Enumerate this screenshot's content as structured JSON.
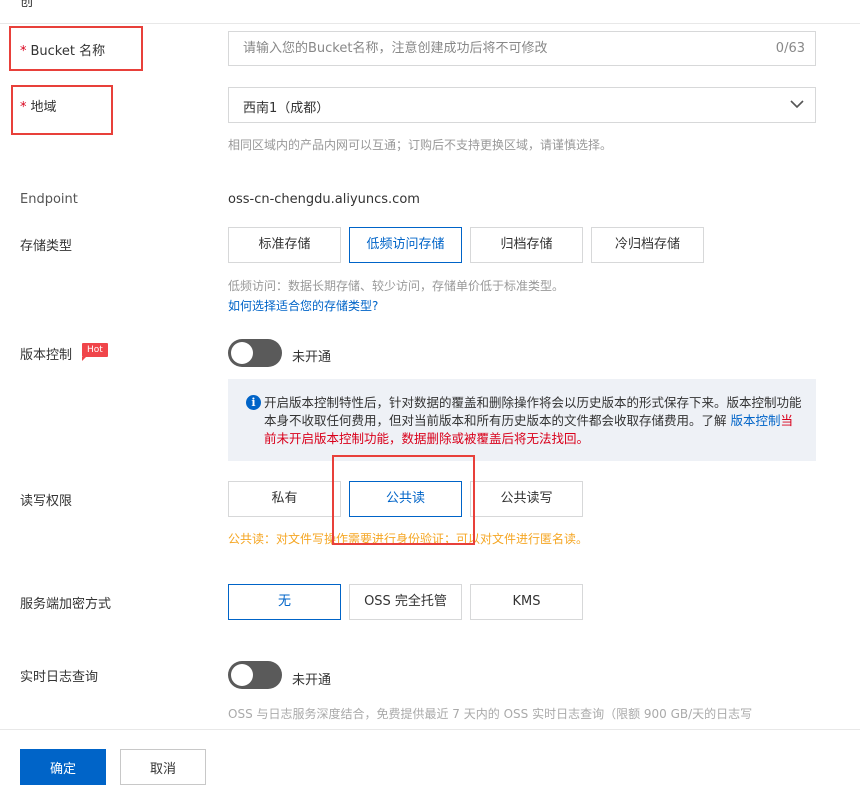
{
  "header": {
    "partial_title": "创"
  },
  "bucket_name": {
    "required_mark": "*",
    "label": "Bucket 名称",
    "placeholder": "请输入您的Bucket名称，注意创建成功后将不可修改",
    "value": "",
    "counter": "0/63"
  },
  "region": {
    "required_mark": "*",
    "label": "地域",
    "selected": "西南1（成都）",
    "hint": "相同区域内的产品内网可以互通；订购后不支持更换区域，请谨慎选择。"
  },
  "endpoint": {
    "label": "Endpoint",
    "value": "oss-cn-chengdu.aliyuncs.com"
  },
  "storage_class": {
    "label": "存储类型",
    "options": [
      "标准存储",
      "低频访问存储",
      "归档存储",
      "冷归档存储"
    ],
    "selected": "低频访问存储",
    "hint": "低频访问：数据长期存储、较少访问，存储单价低于标准类型。",
    "help_link": "如何选择适合您的存储类型?"
  },
  "versioning": {
    "label": "版本控制",
    "badge": "Hot",
    "toggle_state": "未开通",
    "notice_text": "开启版本控制特性后，针对数据的覆盖和删除操作将会以历史版本的形式保存下来。版本控制功能本身不收取任何费用，但对当前版本和所有历史版本的文件都会收取存储费用。了解",
    "notice_link": "版本控制",
    "notice_warning": "当前未开启版本控制功能，数据删除或被覆盖后将无法找回。"
  },
  "acl": {
    "label": "读写权限",
    "options": [
      "私有",
      "公共读",
      "公共读写"
    ],
    "selected": "公共读",
    "warning": "公共读：对文件写操作需要进行身份验证；可以对文件进行匿名读。"
  },
  "encryption": {
    "label": "服务端加密方式",
    "options": [
      "无",
      "OSS 完全托管",
      "KMS"
    ],
    "selected": "无"
  },
  "realtime_log": {
    "label": "实时日志查询",
    "toggle_state": "未开通",
    "desc": "OSS 与日志服务深度结合，免费提供最近 7 天内的 OSS 实时日志查询（限额 900 GB/天的日志写"
  },
  "footer": {
    "confirm": "确定",
    "cancel": "取消"
  },
  "colors": {
    "accent": "#0064c8",
    "required": "#d9001b",
    "warning": "#f5a623",
    "annotation": "#e8403a",
    "toggle_off": "#5a5a5a"
  }
}
